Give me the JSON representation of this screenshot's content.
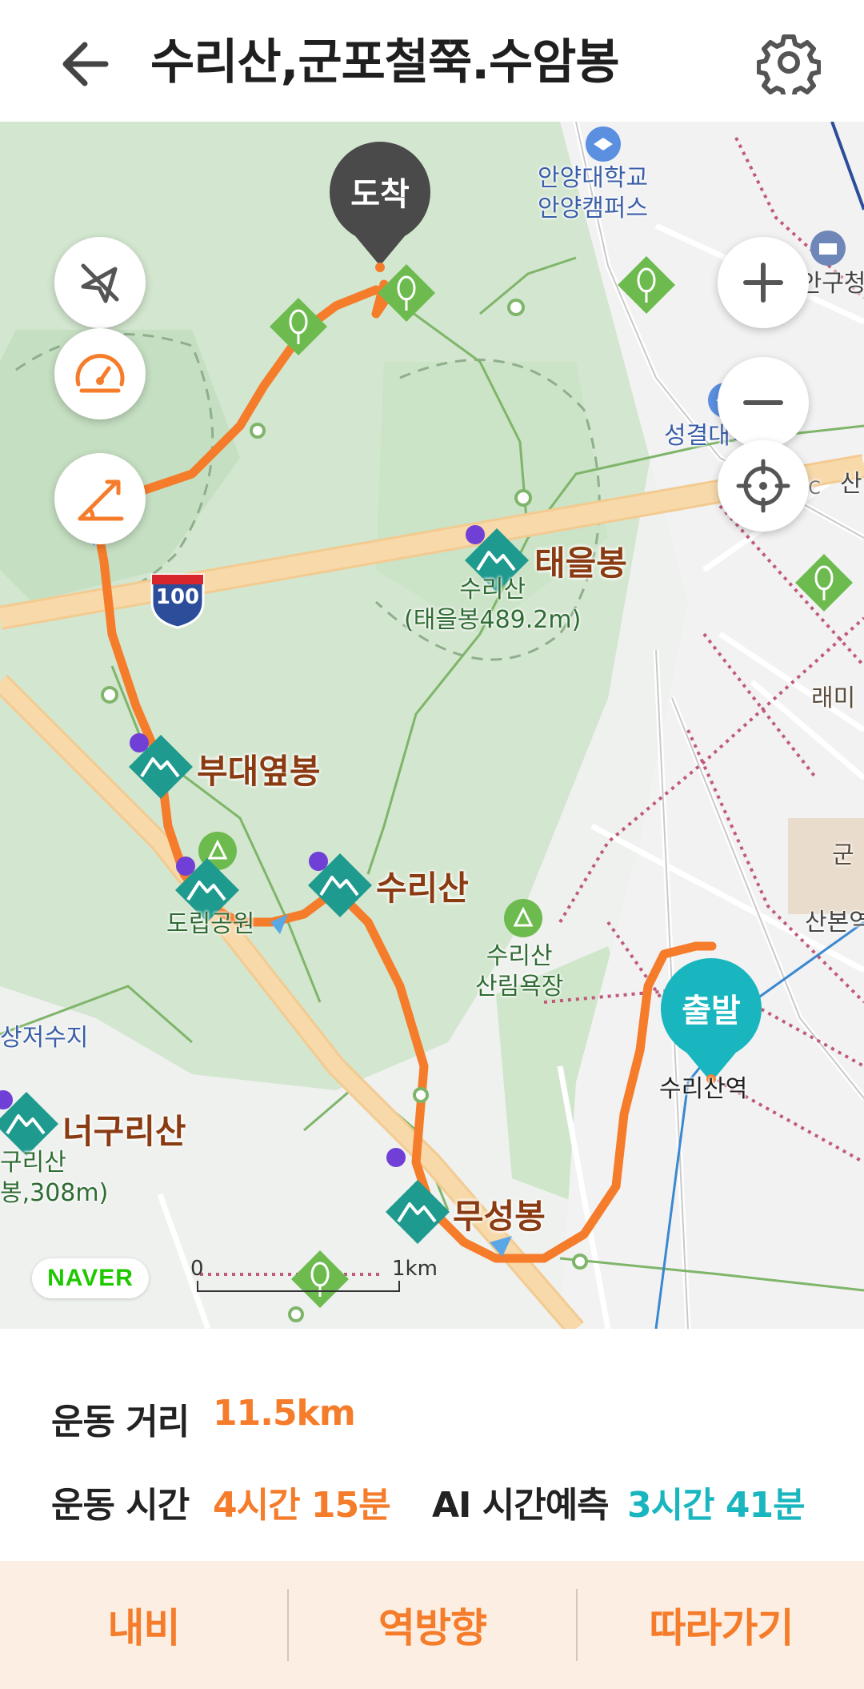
{
  "header": {
    "title": "수리산,군포철쭉.수암봉",
    "back_icon": "arrow-left-icon",
    "settings_icon": "gear-icon"
  },
  "map": {
    "pins": {
      "end": "도착",
      "start": "출발"
    },
    "peaks": [
      {
        "name": "태을봉"
      },
      {
        "name": "부대옆봉"
      },
      {
        "name": "수리산"
      },
      {
        "name": "너구리산"
      },
      {
        "name": "무성봉"
      }
    ],
    "labels": {
      "univ1": "안양대학교",
      "univ2": "안양캠퍼스",
      "city_hall": "만안구청",
      "univ3": "성결대학교",
      "taeeul_sub1": "수리산",
      "taeeul_sub2": "(태을봉489.2m)",
      "park": "도립공원",
      "forest1": "수리산",
      "forest2": "산림욕장",
      "reservoir": "상저수지",
      "neoguri_sub1": "구리산",
      "neoguri_sub2": "봉,308m)",
      "station": "수리산역",
      "sanbon": "산본역",
      "raemi": "래미",
      "gun": "군",
      "ic": "IC",
      "san": "산",
      "highway_no": "100"
    },
    "naver": "NAVER",
    "scale_zero": "0",
    "scale_label": "1km",
    "controls": {
      "compass_icon": "compass-off-icon",
      "speed_icon": "speedometer-icon",
      "slope_icon": "slope-icon",
      "zoom_in_icon": "plus-icon",
      "zoom_out_icon": "minus-icon",
      "locate_icon": "crosshair-icon"
    },
    "colors": {
      "route": "#f57c2a",
      "start_pin": "#19b6bf",
      "end_pin": "#4a4a4a"
    }
  },
  "info": {
    "distance_label": "운동 거리",
    "distance_value": "11.5km",
    "time_label": "운동 시간",
    "time_value": "4시간 15분",
    "ai_label": "AI 시간예측",
    "ai_value": "3시간 41분"
  },
  "actions": {
    "navi": "내비",
    "reverse": "역방향",
    "follow": "따라가기"
  }
}
